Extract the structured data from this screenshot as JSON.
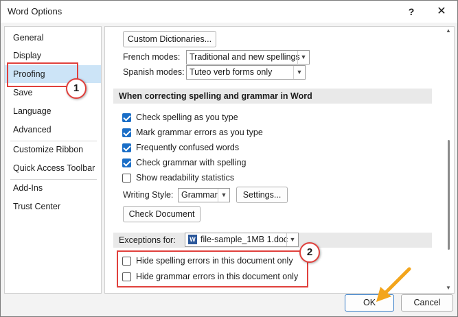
{
  "window": {
    "title": "Word Options",
    "help": "?",
    "close": "✕"
  },
  "sidebar": {
    "items": [
      {
        "label": "General"
      },
      {
        "label": "Display"
      },
      {
        "label": "Proofing"
      },
      {
        "label": "Save"
      },
      {
        "label": "Language"
      },
      {
        "label": "Advanced"
      },
      {
        "label": "Customize Ribbon"
      },
      {
        "label": "Quick Access Toolbar"
      },
      {
        "label": "Add-Ins"
      },
      {
        "label": "Trust Center"
      }
    ],
    "selected": "Proofing"
  },
  "proofing": {
    "custom_dictionaries": "Custom Dictionaries...",
    "french_modes_label": "French modes:",
    "french_modes_value": "Traditional and new spellings",
    "spanish_modes_label": "Spanish modes:",
    "spanish_modes_value": "Tuteo verb forms only",
    "section_title": "When correcting spelling and grammar in Word",
    "options": [
      {
        "label": "Check spelling as you type",
        "checked": true
      },
      {
        "label": "Mark grammar errors as you type",
        "checked": true
      },
      {
        "label": "Frequently confused words",
        "checked": true
      },
      {
        "label": "Check grammar with spelling",
        "checked": true
      },
      {
        "label": "Show readability statistics",
        "checked": false
      }
    ],
    "writing_style_label": "Writing Style:",
    "writing_style_value": "Grammar",
    "settings_button": "Settings...",
    "check_document_button": "Check Document",
    "exceptions_label": "Exceptions for:",
    "exceptions_file": "file-sample_1MB 1.doc",
    "exceptions_options": [
      {
        "label": "Hide spelling errors in this document only",
        "checked": false
      },
      {
        "label": "Hide grammar errors in this document only",
        "checked": false
      }
    ]
  },
  "buttons": {
    "ok": "OK",
    "cancel": "Cancel"
  },
  "annotations": {
    "badge_1": "1",
    "badge_2": "2",
    "highlight_color": "#e0403c",
    "arrow_color": "#f3a51c"
  },
  "colors": {
    "selected_bg": "#cce4f7",
    "checkbox_blue": "#1a6ec7",
    "section_bg": "#e9e9e9"
  }
}
